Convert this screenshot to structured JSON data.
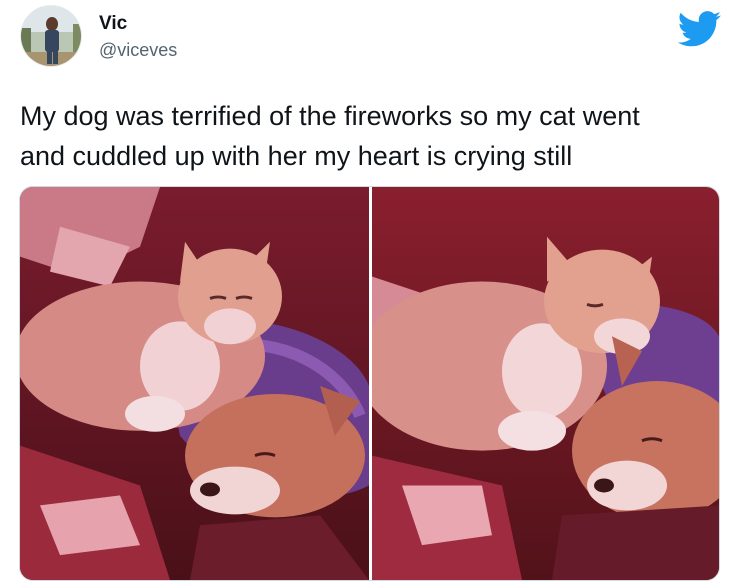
{
  "tweet": {
    "author": {
      "display_name": "Vic",
      "handle": "@viceves",
      "avatar_icon": "profile-photo"
    },
    "brand_icon": "twitter-bird-icon",
    "brand_color": "#1d9bf0",
    "text": "My dog was terrified of the fireworks so my cat went\nand cuddled up with her my heart is crying still",
    "media": {
      "photos": [
        {
          "alt_icon": "cat-and-dog-photo-1"
        },
        {
          "alt_icon": "cat-and-dog-photo-2"
        }
      ]
    }
  }
}
